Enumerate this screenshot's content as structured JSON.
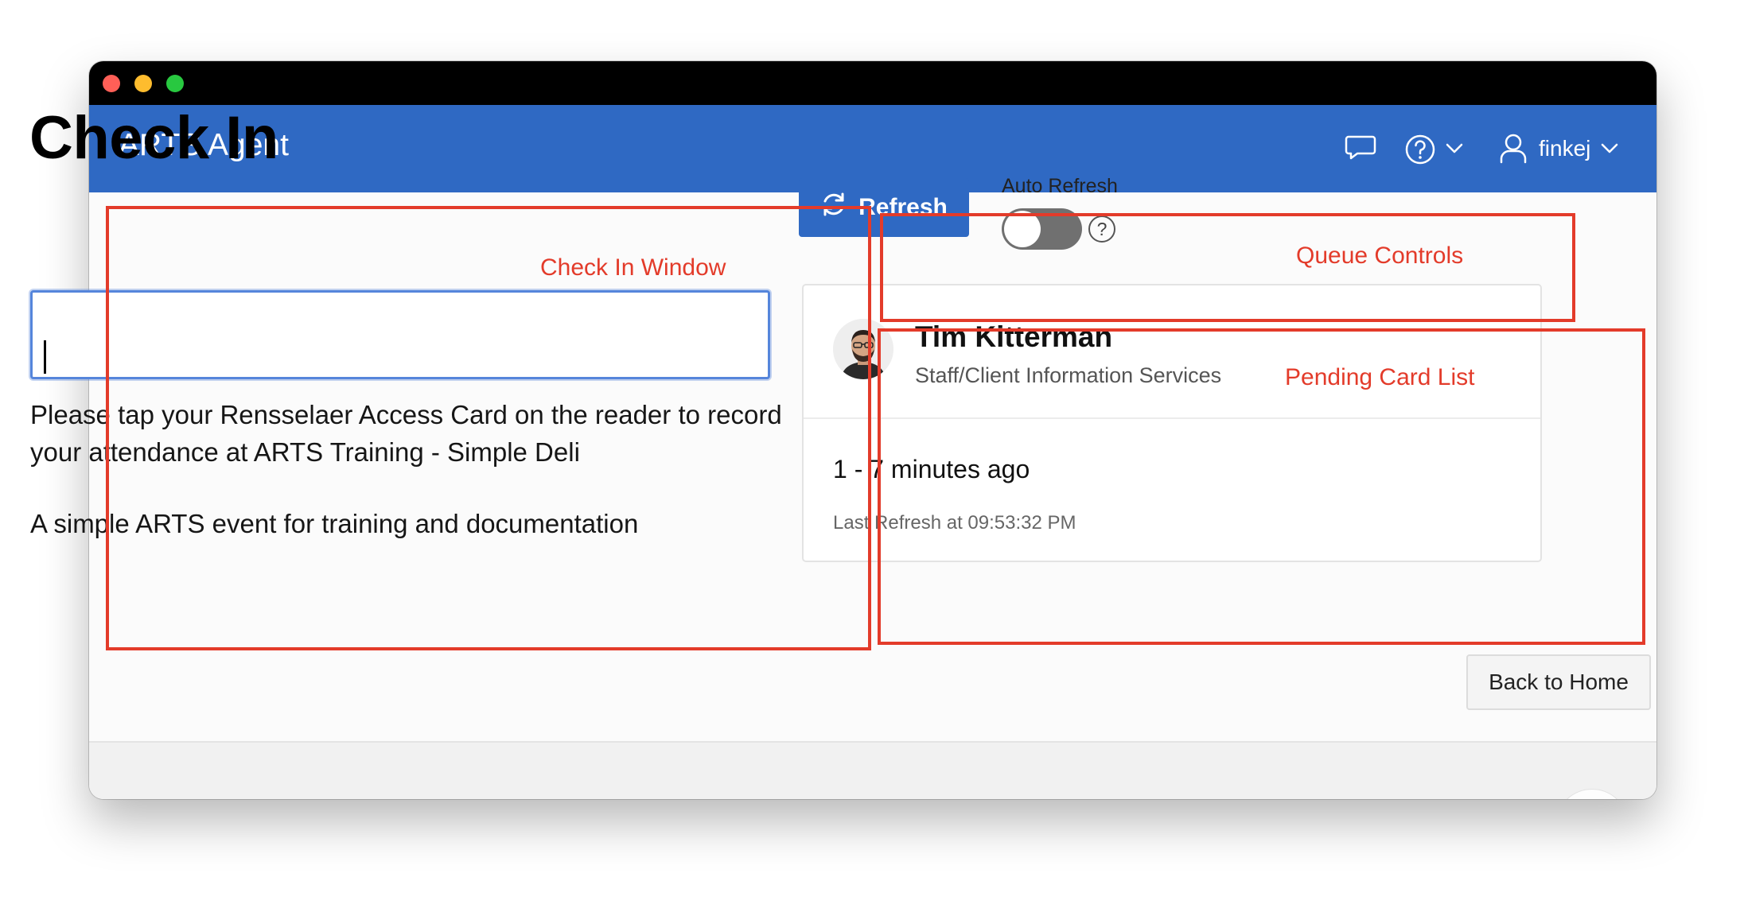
{
  "app": {
    "title": "ARTS Agent",
    "username": "finkej"
  },
  "checkin": {
    "heading": "Check In",
    "input_value": "",
    "instructions": "Please tap your Rensselaer Access Card on the reader to record your attendance at ARTS Training - Simple Deli",
    "description": "A simple ARTS event for training and documentation"
  },
  "queue_controls": {
    "refresh_label": "Refresh",
    "auto_refresh_label": "Auto Refresh",
    "auto_refresh_on": false,
    "help_glyph": "?"
  },
  "pending": {
    "name": "Tim Kitterman",
    "role": "Staff/Client Information Services",
    "count_text": "1 - 7 minutes ago",
    "last_refresh": "Last Refresh at 09:53:32 PM"
  },
  "footer": {
    "back_label": "Back to Home"
  },
  "annotations": {
    "check_in_window": "Check In Window",
    "queue_controls": "Queue Controls",
    "pending_card_list": "Pending Card List"
  },
  "icons": {
    "chat": "chat-bubble-icon",
    "help": "help-circle-icon",
    "user": "user-icon",
    "refresh": "refresh-icon"
  },
  "colors": {
    "brand": "#2f69c3",
    "annotation": "#e33b2a"
  }
}
